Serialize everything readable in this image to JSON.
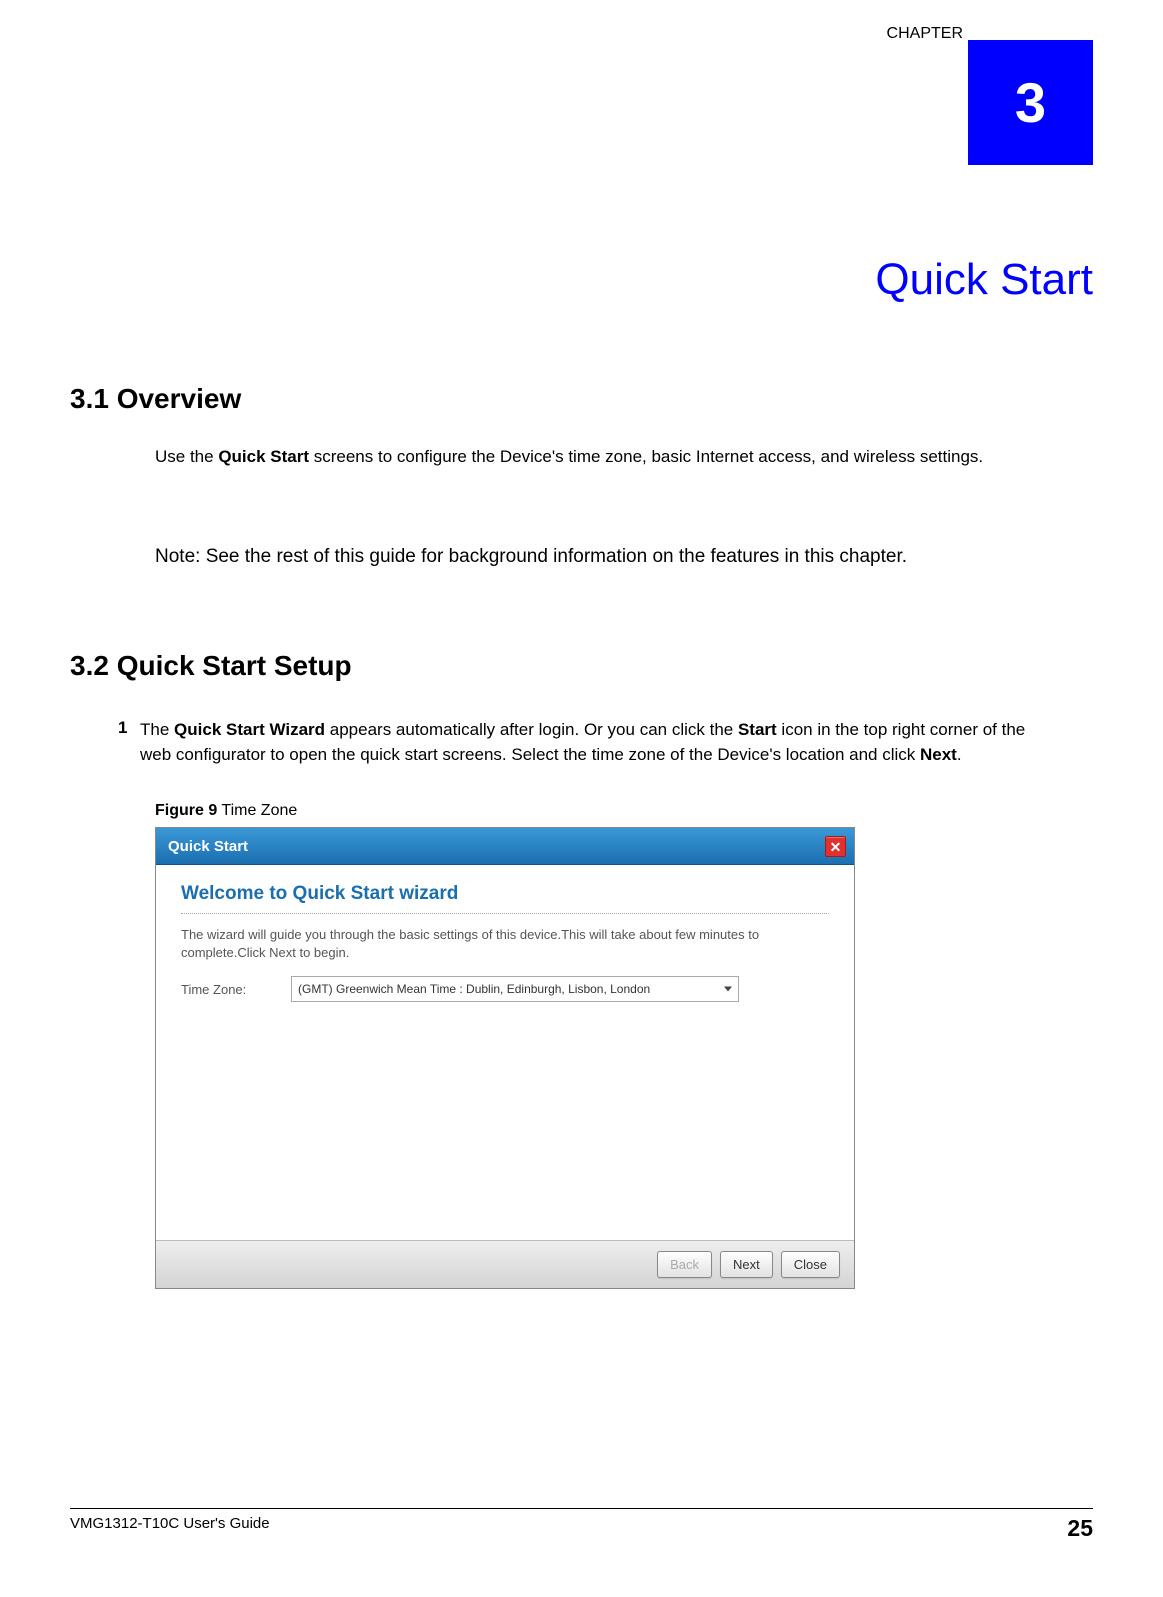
{
  "chapter": {
    "label": "CHAPTER",
    "number": "3",
    "title": "Quick Start"
  },
  "sections": {
    "s1": {
      "heading": "3.1  Overview",
      "para1_a": "Use the ",
      "para1_bold": "Quick Start",
      "para1_b": " screens to configure the Device's time zone, basic Internet access, and wireless settings.",
      "note": "Note: See the rest of this guide for background information on the features in this chapter."
    },
    "s2": {
      "heading": "3.2  Quick Start Setup",
      "step1_num": "1",
      "step1_a": "The ",
      "step1_b1": "Quick Start Wizard",
      "step1_c": " appears automatically after login. Or you can click the  ",
      "step1_b2": "Start",
      "step1_d": " icon in the top right corner of the web configurator to open the quick start screens. Select the time zone of the Device's location and click ",
      "step1_b3": "Next",
      "step1_e": ".",
      "figure_num": "Figure 9",
      "figure_title": "   Time Zone"
    }
  },
  "wizard": {
    "titlebar": "Quick Start",
    "close_glyph": "✕",
    "welcome": "Welcome to Quick Start wizard",
    "description": "The wizard will guide you through the basic settings of this device.This will take about few minutes to complete.Click Next to begin.",
    "tz_label": "Time Zone:",
    "tz_value": "(GMT) Greenwich Mean Time : Dublin, Edinburgh, Lisbon, London",
    "buttons": {
      "back": "Back",
      "next": "Next",
      "close": "Close"
    }
  },
  "footer": {
    "guide": "VMG1312-T10C User's Guide",
    "page": "25"
  }
}
